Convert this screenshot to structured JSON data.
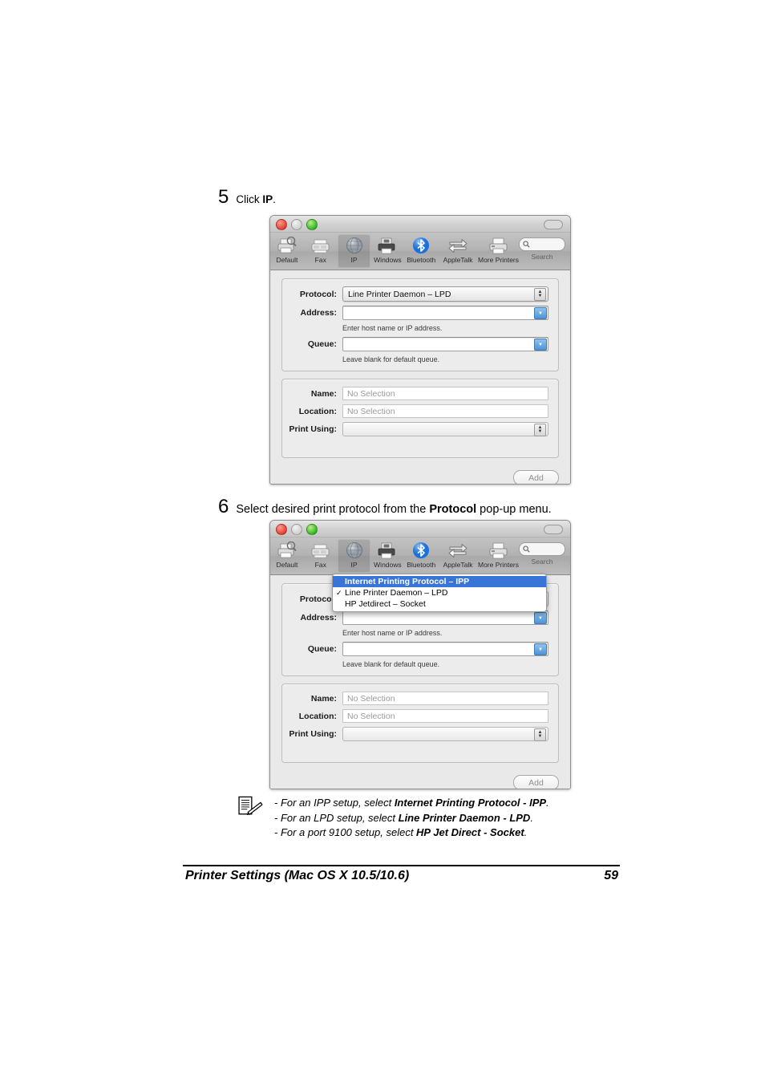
{
  "document": {
    "footer_title": "Printer Settings (Mac OS X 10.5/10.6)",
    "page_number": "59"
  },
  "steps": [
    {
      "number": "5",
      "text_before": "Click ",
      "bold": "IP",
      "text_after": "."
    },
    {
      "number": "6",
      "text_before": "Select desired print protocol from the ",
      "bold": "Protocol",
      "text_after": " pop-up menu."
    }
  ],
  "window": {
    "traffic_lights": [
      "close-button",
      "minimize-button",
      "zoom-button"
    ],
    "toolbar": {
      "items": [
        {
          "label": "Default",
          "icon": "default-printer-icon",
          "selected": false
        },
        {
          "label": "Fax",
          "icon": "fax-icon",
          "selected": false
        },
        {
          "label": "IP",
          "icon": "globe-icon",
          "selected": true
        },
        {
          "label": "Windows",
          "icon": "windows-printer-icon",
          "selected": false
        },
        {
          "label": "Bluetooth",
          "icon": "bluetooth-icon",
          "selected": false
        },
        {
          "label": "AppleTalk",
          "icon": "appletalk-arrows-icon",
          "selected": false
        },
        {
          "label": "More Printers",
          "icon": "more-printers-icon",
          "selected": false
        }
      ],
      "search": {
        "label": "Search",
        "placeholder": ""
      }
    }
  },
  "screen1": {
    "protocol": {
      "label": "Protocol:",
      "value": "Line Printer Daemon – LPD"
    },
    "address": {
      "label": "Address:",
      "value": "",
      "hint": "Enter host name or IP address."
    },
    "queue": {
      "label": "Queue:",
      "value": "",
      "hint": "Leave blank for default queue."
    },
    "name": {
      "label": "Name:",
      "value": "No Selection"
    },
    "location": {
      "label": "Location:",
      "value": "No Selection"
    },
    "print_using": {
      "label": "Print Using:",
      "value": ""
    },
    "add_button": "Add"
  },
  "screen2": {
    "protocol": {
      "label": "Protocol:",
      "value": "Line Printer Daemon – LPD"
    },
    "address": {
      "label": "Address:",
      "value": "",
      "hint": "Enter host name or IP address."
    },
    "queue": {
      "label": "Queue:",
      "value": "",
      "hint": "Leave blank for default queue."
    },
    "name": {
      "label": "Name:",
      "value": "No Selection"
    },
    "location": {
      "label": "Location:",
      "value": "No Selection"
    },
    "print_using": {
      "label": "Print Using:",
      "value": ""
    },
    "add_button": "Add",
    "protocol_menu": {
      "open": true,
      "options": [
        {
          "label": "Internet Printing Protocol – IPP",
          "checked": false,
          "highlighted": true
        },
        {
          "label": "Line Printer Daemon – LPD",
          "checked": true,
          "highlighted": false
        },
        {
          "label": "HP Jetdirect – Socket",
          "checked": false,
          "highlighted": false
        }
      ]
    }
  },
  "note": {
    "icon": "note-pencil-icon",
    "lines": [
      {
        "prefix": "- For an IPP setup, select ",
        "bold": "Internet Printing Protocol - IPP",
        "suffix": "."
      },
      {
        "prefix": "- For an LPD setup, select ",
        "bold": "Line Printer Daemon - LPD",
        "suffix": "."
      },
      {
        "prefix": "- For a port 9100 setup, select ",
        "bold": "HP Jet Direct - Socket",
        "suffix": "."
      }
    ]
  },
  "colors": {
    "menu_highlight": "#3875d7",
    "bluetooth_blue": "#1f7ced",
    "window_bg": "#e9e9e9"
  }
}
